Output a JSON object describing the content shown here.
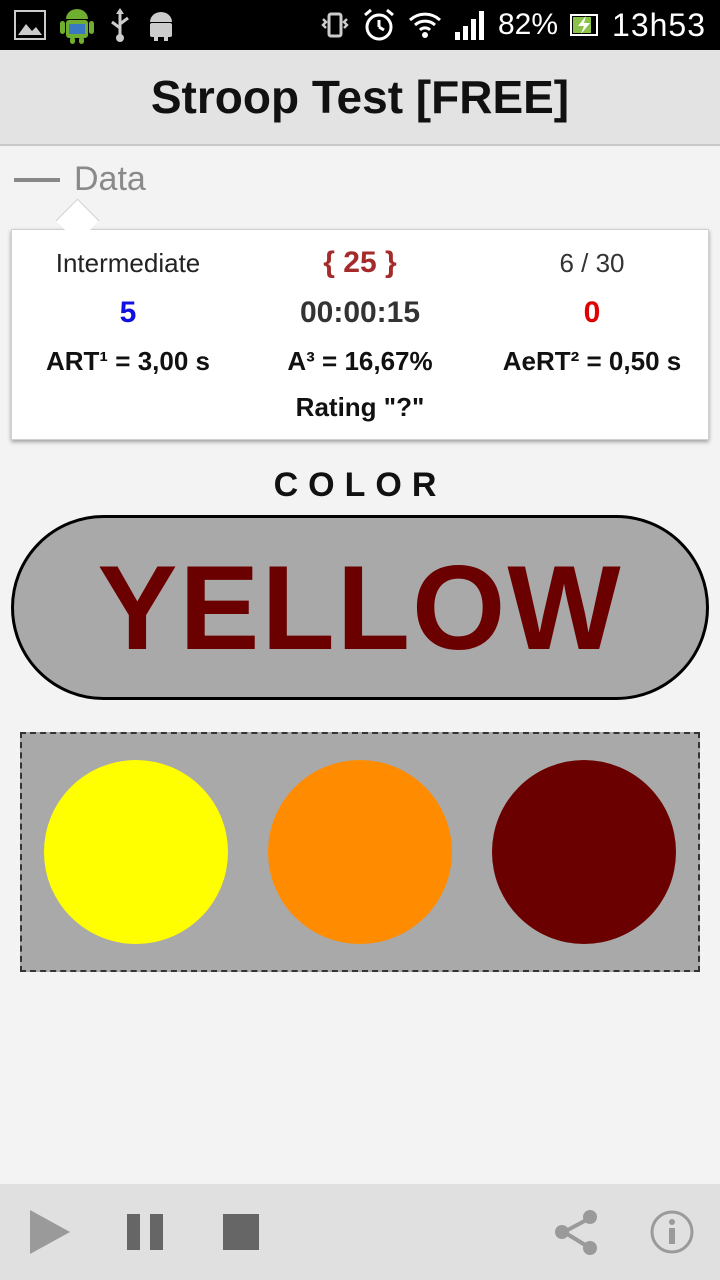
{
  "status_bar": {
    "battery": "82%",
    "time": "13h53"
  },
  "app": {
    "title": "Stroop Test [FREE]"
  },
  "data_section": {
    "label": "Data",
    "level": "Intermediate",
    "round": "{ 25 }",
    "progress": "6 / 30",
    "correct": "5",
    "timer": "00:00:15",
    "errors": "0",
    "art": "ART¹ = 3,00 s",
    "accuracy": "A³ = 16,67%",
    "aert": "AeRT² = 0,50 s",
    "rating": "Rating \"?\""
  },
  "stimulus": {
    "label": "COLOR",
    "word": "YELLOW",
    "word_color": "#6b0000"
  },
  "choices": [
    {
      "name": "yellow",
      "color": "#ffff00"
    },
    {
      "name": "orange",
      "color": "#ff8c00"
    },
    {
      "name": "dark-red",
      "color": "#6b0000"
    }
  ],
  "toolbar": {
    "icons": [
      "play-icon",
      "pause-icon",
      "stop-icon",
      "share-icon",
      "info-icon"
    ]
  }
}
